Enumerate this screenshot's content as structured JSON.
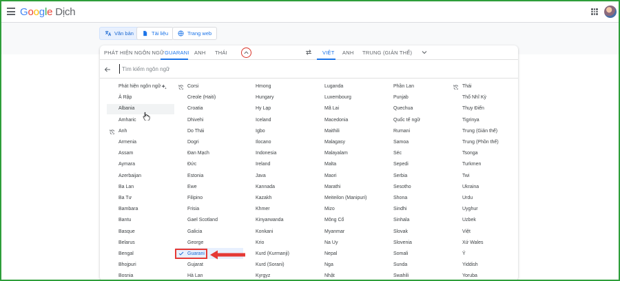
{
  "header": {
    "logo_text": "Google",
    "app_name": "Dịch",
    "menu_icon": "hamburger-menu-icon",
    "apps_icon": "apps-grid-icon",
    "avatar": "user-avatar"
  },
  "modes": [
    {
      "label": "Văn bản",
      "icon": "translate-text-icon",
      "active": true
    },
    {
      "label": "Tài liệu",
      "icon": "document-icon",
      "active": false
    },
    {
      "label": "Trang web",
      "icon": "globe-icon",
      "active": false
    }
  ],
  "source_tabs": [
    "PHÁT HIỆN NGÔN NGỮ",
    "GUARANI",
    "ANH",
    "THÁI"
  ],
  "source_active": "GUARANI",
  "target_tabs": [
    "VIỆT",
    "ANH",
    "TRUNG (GIẢN THỂ)"
  ],
  "target_active": "VIỆT",
  "search": {
    "placeholder": "Tìm kiếm ngôn ngữ"
  },
  "columns": [
    [
      "Phát hiện ngôn ngữ",
      "Ả Rập",
      "Albania",
      "Amharic",
      "Anh",
      "Armenia",
      "Assam",
      "Aymara",
      "Azerbaijan",
      "Ba Lan",
      "Ba Tư",
      "Bambara",
      "Bantu",
      "Basque",
      "Belarus",
      "Bengal",
      "Bhojpuri",
      "Bosnia"
    ],
    [
      "Corsi",
      "Creole (Haiti)",
      "Croatia",
      "Dhivehi",
      "Do Thái",
      "Dogri",
      "Đan Mạch",
      "Đức",
      "Estonia",
      "Ewe",
      "Filipino",
      "Frisia",
      "Gael Scotland",
      "Galicia",
      "George",
      "Guarani",
      "Gujarat",
      "Hà Lan"
    ],
    [
      "Hmong",
      "Hungary",
      "Hy Lạp",
      "Iceland",
      "Igbo",
      "Ilocano",
      "Indonesia",
      "Ireland",
      "Java",
      "Kannada",
      "Kazakh",
      "Khmer",
      "Kinyarwanda",
      "Konkani",
      "Krio",
      "Kurd (Kurmanji)",
      "Kurd (Sorani)",
      "Kyrgyz"
    ],
    [
      "Luganda",
      "Luxembourg",
      "Mã Lai",
      "Macedonia",
      "Maithili",
      "Malagasy",
      "Malayalam",
      "Malta",
      "Maori",
      "Marathi",
      "Meiteilon (Manipuri)",
      "Mizo",
      "Mông Cổ",
      "Myanmar",
      "Na Uy",
      "Nepal",
      "Nga",
      "Nhật"
    ],
    [
      "Phần Lan",
      "Punjab",
      "Quechua",
      "Quốc tế ngữ",
      "Rumani",
      "Samoa",
      "Séc",
      "Sepedi",
      "Serbia",
      "Sesotho",
      "Shona",
      "Sindhi",
      "Sinhala",
      "Slovak",
      "Slovenia",
      "Somali",
      "Sunda",
      "Swahili"
    ],
    [
      "Thái",
      "Thổ Nhĩ Kỳ",
      "Thụy Điển",
      "Tigrinya",
      "Trung (Giản thể)",
      "Trung (Phồn thể)",
      "Tsonga",
      "Turkmen",
      "Twi",
      "Ukraina",
      "Urdu",
      "Uyghur",
      "Uzbek",
      "Việt",
      "Xứ Wales",
      "Ý",
      "Yiddish",
      "Yoruba"
    ]
  ],
  "recent_markers": [
    "Anh",
    "Corsi",
    "Thái"
  ],
  "hovered_language": "Albania",
  "selected_language": "Guarani",
  "colors": {
    "accent": "#1a73e8",
    "annotation": "#e53935",
    "frame": "#2e9e3a"
  }
}
